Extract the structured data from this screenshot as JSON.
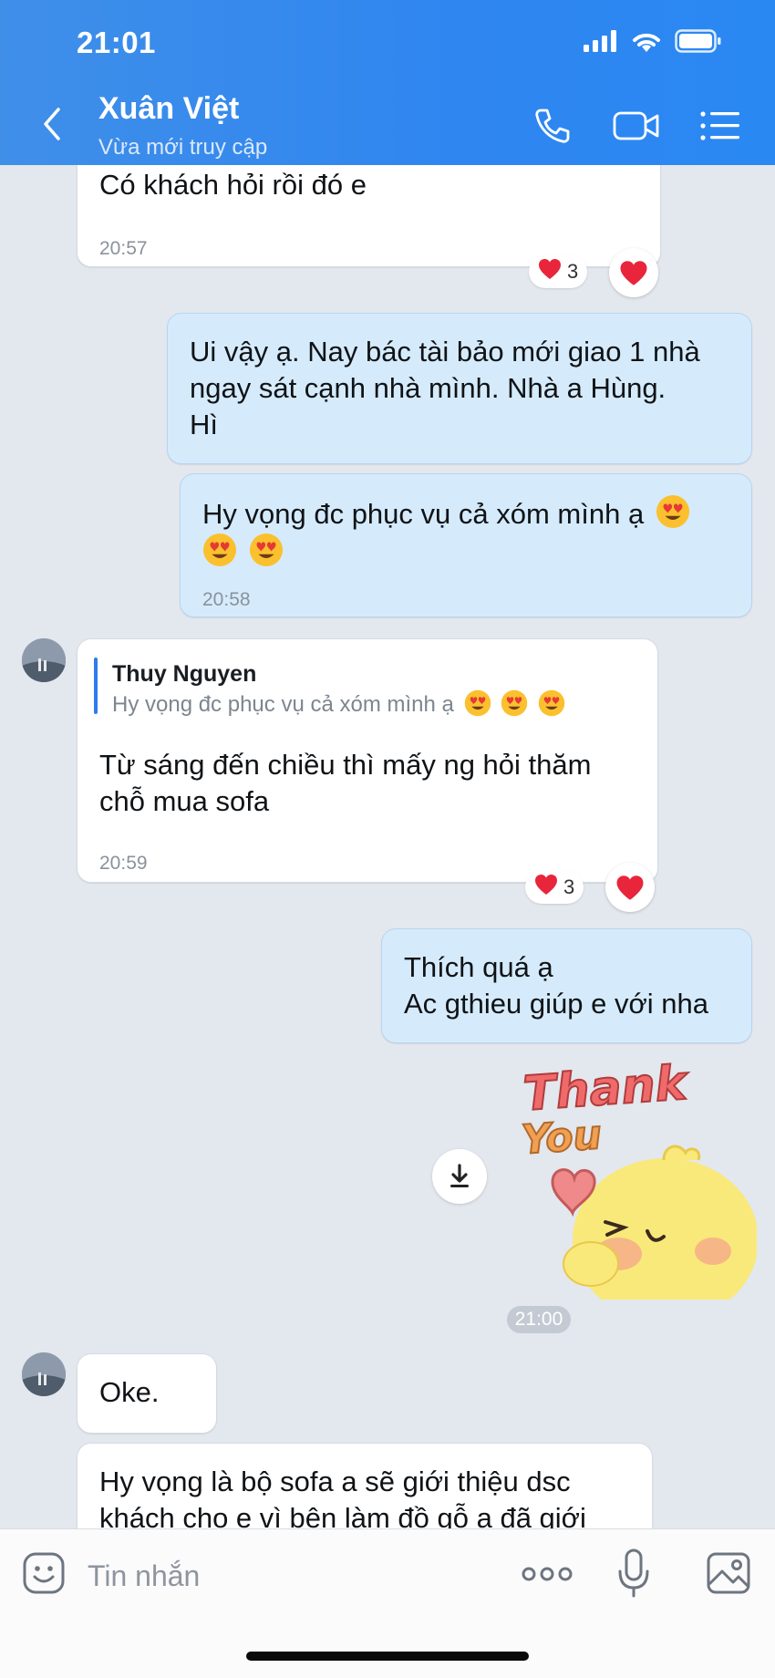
{
  "status_bar": {
    "time": "21:01"
  },
  "header": {
    "name": "Xuân Việt",
    "status": "Vừa mới truy cập",
    "icons": [
      "back-icon",
      "phone-icon",
      "video-icon",
      "menu-list-icon"
    ]
  },
  "messages": {
    "m1": {
      "text": "Có khách hỏi rồi đó e",
      "time": "20:57",
      "reaction_count": "3"
    },
    "m2": {
      "line1": "Ui vậy ạ. Nay bác tài bảo mới giao 1 nhà",
      "line2": "ngay sát cạnh nhà mình. Nhà a Hùng.",
      "line3": "Hì"
    },
    "m3": {
      "text": "Hy vọng đc phục vụ cả xóm mình ạ",
      "time": "20:58"
    },
    "m4": {
      "quote_name": "Thuy Nguyen",
      "quote_text": "Hy vọng đc phục vụ cả xóm mình ạ",
      "line1": "Từ sáng đến chiều thì mấy ng hỏi thăm",
      "line2": "chỗ mua sofa",
      "time": "20:59",
      "reaction_count": "3"
    },
    "m5": {
      "line1": "Thích quá ạ",
      "line2": "Ac gthieu giúp e với nha"
    },
    "sticker": {
      "text1": "Thank",
      "text2": "You"
    },
    "divider_time": "21:00",
    "m6": {
      "text": "Oke."
    },
    "m7": {
      "line1": "Hy vọng là bộ sofa a sẽ giới thiệu dsc",
      "line2": "khách cho e vì bên làm đồ gỗ a đã giới"
    }
  },
  "input": {
    "placeholder": "Tin nhắn"
  },
  "colors": {
    "header": "#2f86f0",
    "outgoing_bubble": "#d5ebfc",
    "incoming_bubble": "#ffffff",
    "background": "#e3e7ee",
    "heart": "#e8253b"
  }
}
